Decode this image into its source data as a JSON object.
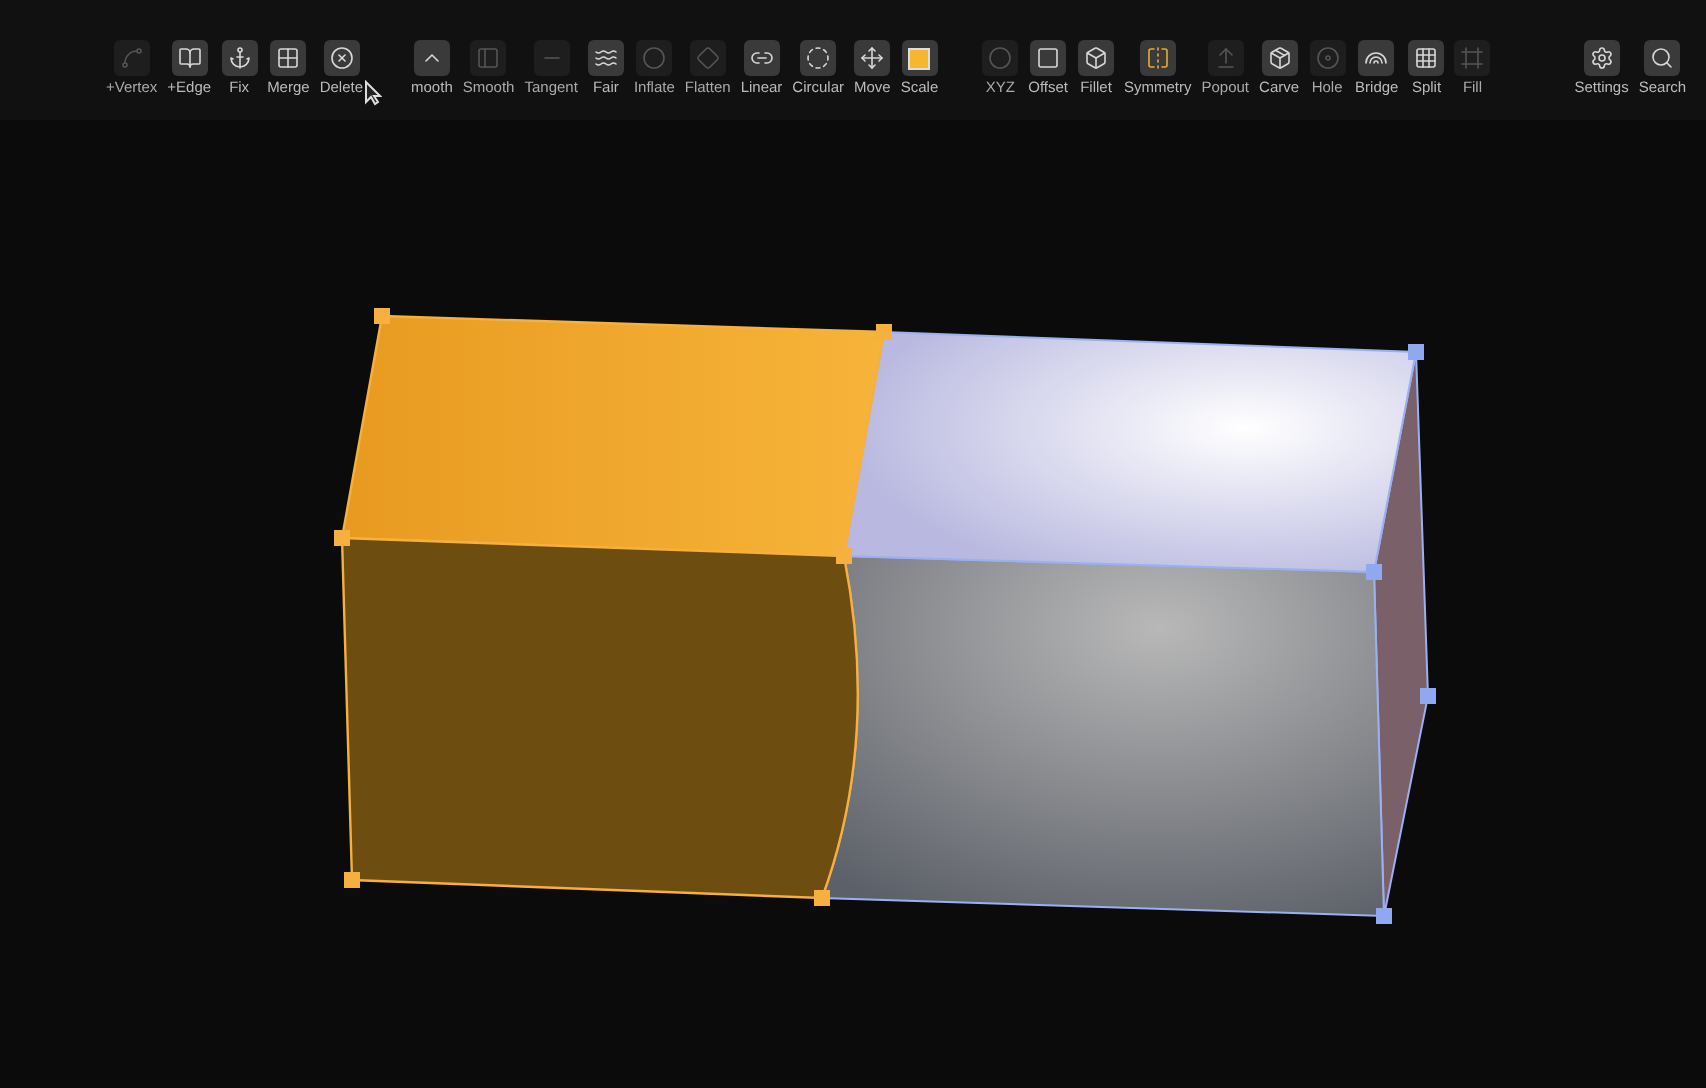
{
  "toolbar": {
    "groups": [
      {
        "tools": [
          {
            "label": "+Vertex",
            "disabled": true
          },
          {
            "label": "+Edge",
            "disabled": false
          },
          {
            "label": "Fix",
            "disabled": false
          },
          {
            "label": "Merge",
            "disabled": false
          },
          {
            "label": "Delete",
            "disabled": false
          }
        ]
      },
      {
        "tools": [
          {
            "label": "mooth",
            "disabled": false
          },
          {
            "label": "Smooth",
            "disabled": true
          },
          {
            "label": "Tangent",
            "disabled": true
          },
          {
            "label": "Fair",
            "disabled": false
          },
          {
            "label": "Inflate",
            "disabled": true
          },
          {
            "label": "Flatten",
            "disabled": true
          },
          {
            "label": "Linear",
            "disabled": false
          },
          {
            "label": "Circular",
            "disabled": false
          },
          {
            "label": "Move",
            "disabled": false
          },
          {
            "label": "Scale",
            "disabled": false
          }
        ]
      },
      {
        "tools": [
          {
            "label": "XYZ",
            "disabled": true
          },
          {
            "label": "Offset",
            "disabled": false
          },
          {
            "label": "Fillet",
            "disabled": false
          },
          {
            "label": "Symmetry",
            "disabled": false
          },
          {
            "label": "Popout",
            "disabled": true
          },
          {
            "label": "Carve",
            "disabled": false
          },
          {
            "label": "Hole",
            "disabled": true
          },
          {
            "label": "Bridge",
            "disabled": false
          },
          {
            "label": "Split",
            "disabled": false
          },
          {
            "label": "Fill",
            "disabled": true
          }
        ]
      },
      {
        "tools": [
          {
            "label": "Settings",
            "disabled": false
          },
          {
            "label": "Search",
            "disabled": false
          }
        ]
      }
    ]
  }
}
